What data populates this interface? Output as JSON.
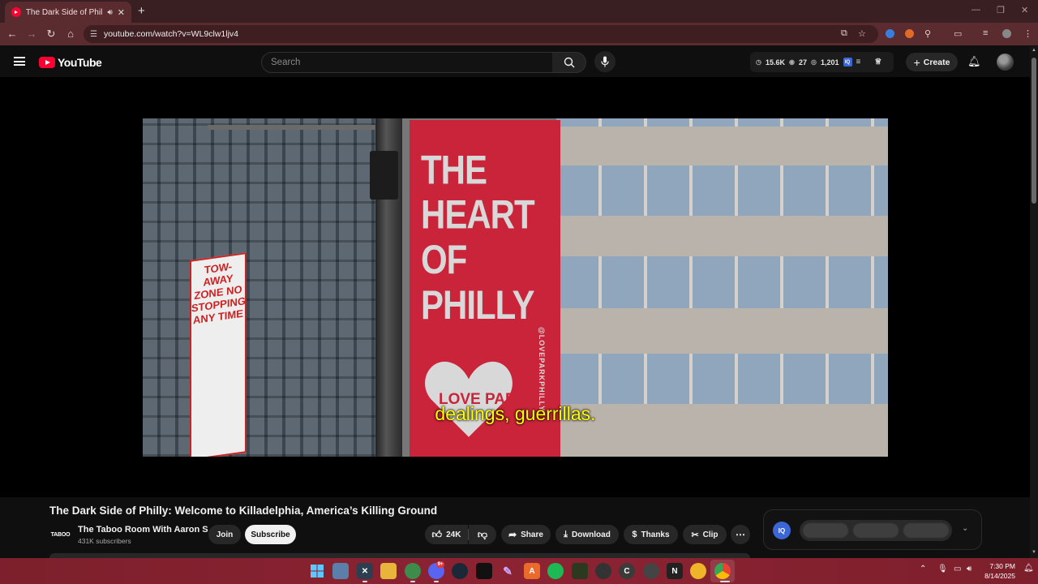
{
  "browser": {
    "tab_title": "The Dark Side of Philly: Wel",
    "tab_audio_icon": "speaker-icon",
    "url": "youtube.com/watch?v=WL9clw1ljv4"
  },
  "masthead": {
    "logo_text": "YouTube",
    "search_placeholder": "Search",
    "stats": {
      "views": "15.6K",
      "watching": "27",
      "viewers": "1,201"
    },
    "create_label": "Create"
  },
  "video": {
    "banner_text": "THE HEART OF PHILLY",
    "banner_handle": "@LOVEPARKPHILLY",
    "heart_text": "LOVE PARK",
    "sign_text": "TOW-AWAY ZONE NO STOPPING ANY TIME",
    "caption": "dealings, guerrillas."
  },
  "info": {
    "title": "The Dark Side of Philly: Welcome to Killadelphia, America’s Killing Ground",
    "channel_avatar_text": "TABOO",
    "channel_name": "The Taboo Room With Aaron S",
    "subscribers": "431K subscribers",
    "join_label": "Join",
    "subscribe_label": "Subscribe",
    "likes": "24K",
    "share_label": "Share",
    "download_label": "Download",
    "thanks_label": "Thanks",
    "clip_label": "Clip",
    "extension_badge": "IQ"
  },
  "taskbar": {
    "time": "7:30 PM",
    "date": "8/14/2025",
    "steam_badge": "9+"
  },
  "colors": {
    "youtube_red": "#ff0033",
    "chrome_frame": "#5a2c30",
    "taskbar": "#8c2333",
    "caption": "#ffff00",
    "banner": "#c9243a"
  }
}
